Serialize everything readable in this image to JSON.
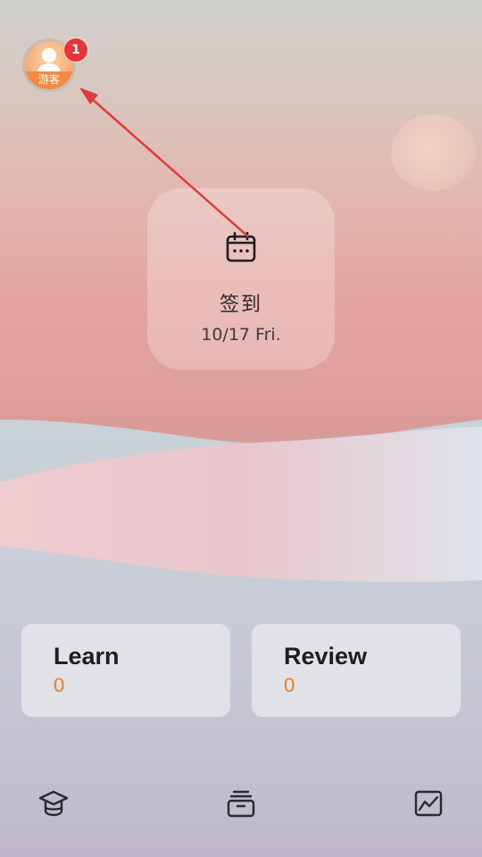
{
  "user": {
    "avatar_label": "游客",
    "notification_count": "1"
  },
  "checkin": {
    "label": "签到",
    "date": "10/17 Fri.",
    "icon": "calendar-icon"
  },
  "stats": {
    "learn": {
      "title": "Learn",
      "value": "0"
    },
    "review": {
      "title": "Review",
      "value": "0"
    }
  },
  "bottom_nav": {
    "items": [
      {
        "icon": "graduation-cap-icon"
      },
      {
        "icon": "archive-icon"
      },
      {
        "icon": "line-chart-icon"
      }
    ]
  },
  "colors": {
    "accent_orange": "#f07c1e",
    "badge_red": "#e8333a",
    "arrow_red": "#e23a3a"
  }
}
